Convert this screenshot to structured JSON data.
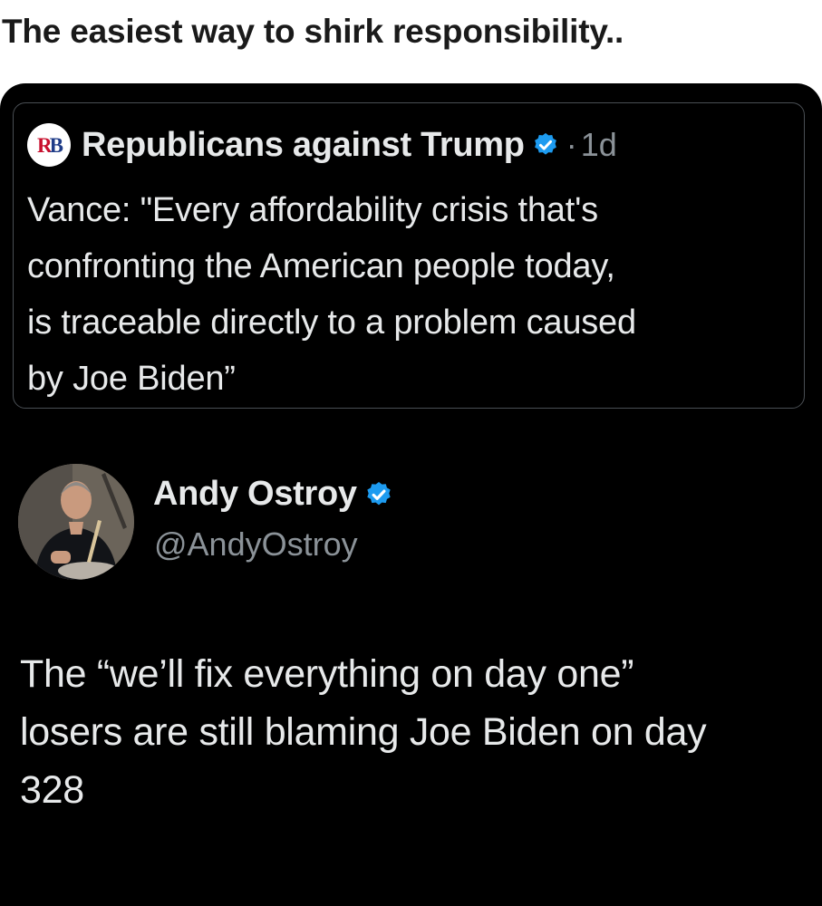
{
  "caption": "The easiest way to shirk responsibility..",
  "quoted_tweet": {
    "avatar_letters": [
      "R",
      "B"
    ],
    "author": "Republicans against Trump",
    "verified_icon": "verified-badge-icon",
    "separator": "·",
    "time": "1d",
    "text_lines": [
      "Vance: \"Every affordability crisis that's",
      "confronting the American people today,",
      "is traceable directly to a problem caused",
      "by Joe Biden”"
    ]
  },
  "tweet": {
    "author": "Andy Ostroy",
    "verified_icon": "verified-badge-icon",
    "handle": "@AndyOstroy",
    "text_lines": [
      "The “we’ll fix everything on day one”",
      "losers are still blaming Joe Biden on day",
      "328"
    ]
  },
  "colors": {
    "background": "#000000",
    "text": "#e7e9ea",
    "muted": "#8b9298",
    "verified": "#1d9bf0"
  }
}
